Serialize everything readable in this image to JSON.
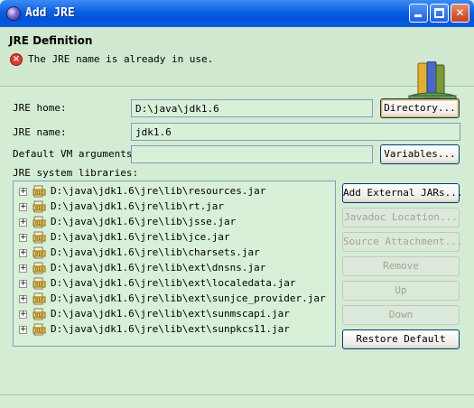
{
  "window": {
    "title": "Add JRE"
  },
  "header": {
    "title": "JRE Definition",
    "message": "The JRE name is already in use."
  },
  "form": {
    "jre_home_label": "JRE home:",
    "jre_home_value": "D:\\java\\jdk1.6",
    "directory_button": "Directory...",
    "jre_name_label": "JRE name:",
    "jre_name_value": "jdk1.6",
    "vm_args_label": "Default VM arguments:",
    "vm_args_value": "",
    "variables_button": "Variables...",
    "libraries_label": "JRE system libraries:"
  },
  "libraries": [
    "D:\\java\\jdk1.6\\jre\\lib\\resources.jar",
    "D:\\java\\jdk1.6\\jre\\lib\\rt.jar",
    "D:\\java\\jdk1.6\\jre\\lib\\jsse.jar",
    "D:\\java\\jdk1.6\\jre\\lib\\jce.jar",
    "D:\\java\\jdk1.6\\jre\\lib\\charsets.jar",
    "D:\\java\\jdk1.6\\jre\\lib\\ext\\dnsns.jar",
    "D:\\java\\jdk1.6\\jre\\lib\\ext\\localedata.jar",
    "D:\\java\\jdk1.6\\jre\\lib\\ext\\sunjce_provider.jar",
    "D:\\java\\jdk1.6\\jre\\lib\\ext\\sunmscapi.jar",
    "D:\\java\\jdk1.6\\jre\\lib\\ext\\sunpkcs11.jar"
  ],
  "side_buttons": {
    "add_external_jars": "Add External JARs...",
    "javadoc_location": "Javadoc Location...",
    "source_attachment": "Source Attachment...",
    "remove": "Remove",
    "up": "Up",
    "down": "Down",
    "restore_default": "Restore Default"
  },
  "colors": {
    "titlebar": "#0a5fe0",
    "background": "#d4ecd4",
    "error": "#d93c2a"
  }
}
